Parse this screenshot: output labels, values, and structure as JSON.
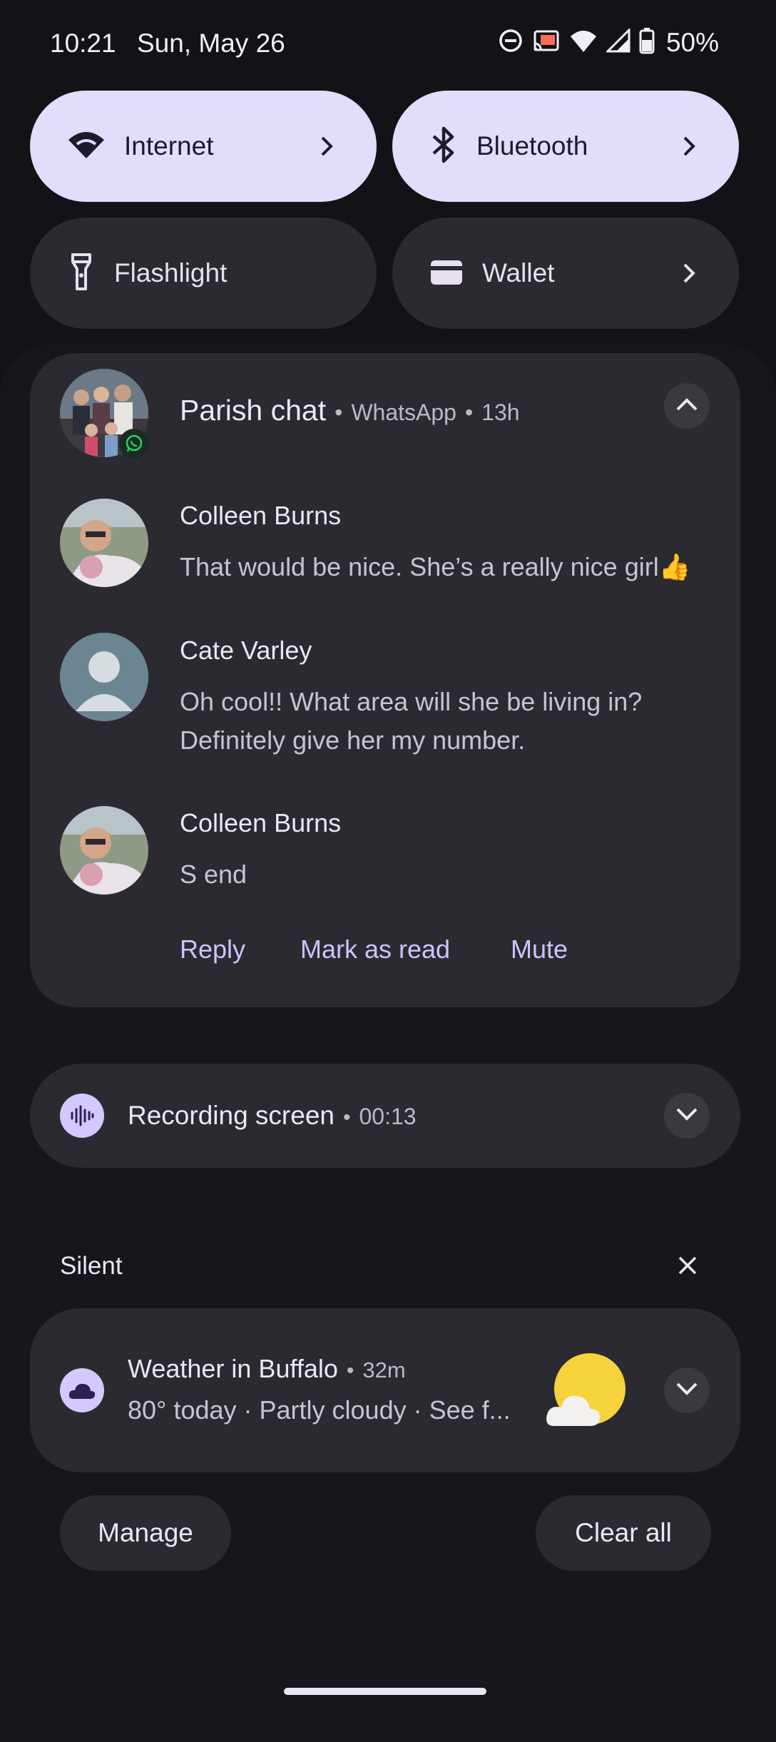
{
  "status_bar": {
    "time": "10:21",
    "date": "Sun, May 26",
    "battery": "50%",
    "icons": [
      "do-not-disturb-icon",
      "cast-icon",
      "wifi-icon",
      "signal-icon",
      "battery-icon"
    ]
  },
  "tiles": [
    {
      "label": "Internet",
      "icon": "wifi-icon",
      "active": true
    },
    {
      "label": "Bluetooth",
      "icon": "bluetooth-icon",
      "active": true
    },
    {
      "label": "Flashlight",
      "icon": "flashlight-icon",
      "active": false
    },
    {
      "label": "Wallet",
      "icon": "wallet-icon",
      "active": false
    }
  ],
  "chat": {
    "title": "Parish chat",
    "app": "WhatsApp",
    "age": "13h",
    "messages": [
      {
        "sender": "Colleen Burns",
        "text": "That would be nice. She’s a really nice girl👍"
      },
      {
        "sender": "Cate Varley",
        "text_line1": "Oh cool!! What area will she be living in?",
        "text_line2": "Definitely give her my number."
      },
      {
        "sender": "Colleen Burns",
        "text": "S end"
      }
    ],
    "actions": {
      "reply": "Reply",
      "mark_read": "Mark as read",
      "mute": "Mute"
    }
  },
  "recording": {
    "title": "Recording screen",
    "elapsed": "00:13"
  },
  "silent": {
    "header": "Silent",
    "weather": {
      "title": "Weather in Buffalo",
      "age": "32m",
      "text": "80° today · Partly cloudy · See f..."
    }
  },
  "footer": {
    "manage": "Manage",
    "clear_all": "Clear all"
  },
  "colors": {
    "accent": "#cfc2ff",
    "tile_active": "#e3dcfb",
    "surface": "#2b2a31",
    "background": "#131217",
    "whatsapp": "#25d366"
  }
}
